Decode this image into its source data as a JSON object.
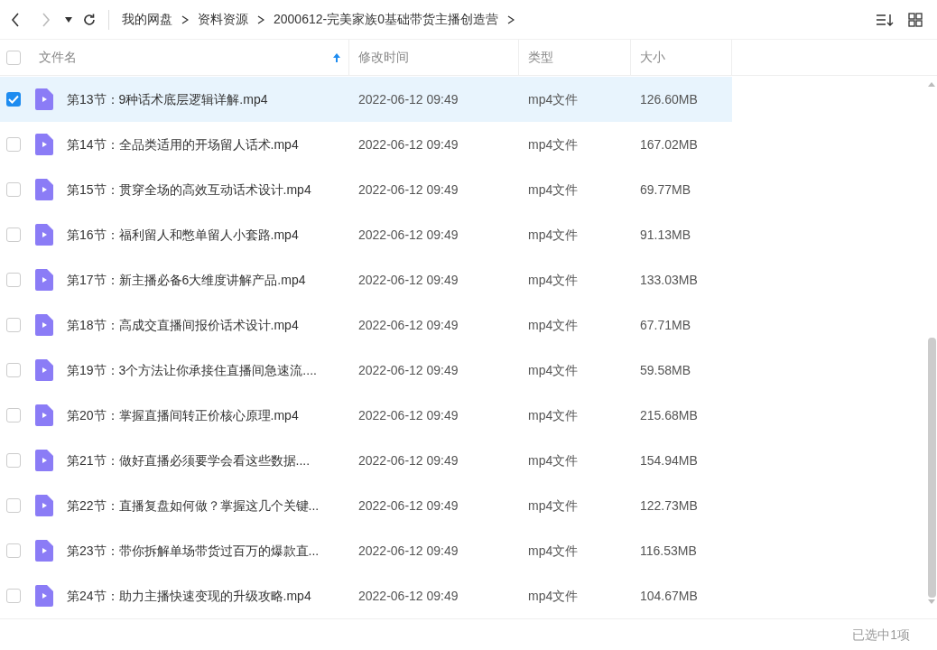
{
  "breadcrumb": [
    "我的网盘",
    "资料资源",
    "2000612-完美家族0基础带货主播创造营"
  ],
  "columns": [
    {
      "label": "文件名",
      "sorted": true
    },
    {
      "label": "修改时间",
      "sorted": false
    },
    {
      "label": "类型",
      "sorted": false
    },
    {
      "label": "大小",
      "sorted": false
    }
  ],
  "header_checked": false,
  "rows": [
    {
      "name": "第13节：9种话术底层逻辑详解.mp4",
      "modified": "2022-06-12 09:49",
      "type": "mp4文件",
      "size": "126.60MB",
      "selected": true
    },
    {
      "name": "第14节：全品类适用的开场留人话术.mp4",
      "modified": "2022-06-12 09:49",
      "type": "mp4文件",
      "size": "167.02MB",
      "selected": false
    },
    {
      "name": "第15节：贯穿全场的高效互动话术设计.mp4",
      "modified": "2022-06-12 09:49",
      "type": "mp4文件",
      "size": "69.77MB",
      "selected": false
    },
    {
      "name": "第16节：福利留人和憋单留人小套路.mp4",
      "modified": "2022-06-12 09:49",
      "type": "mp4文件",
      "size": "91.13MB",
      "selected": false
    },
    {
      "name": "第17节：新主播必备6大维度讲解产品.mp4",
      "modified": "2022-06-12 09:49",
      "type": "mp4文件",
      "size": "133.03MB",
      "selected": false
    },
    {
      "name": "第18节：高成交直播间报价话术设计.mp4",
      "modified": "2022-06-12 09:49",
      "type": "mp4文件",
      "size": "67.71MB",
      "selected": false
    },
    {
      "name": "第19节：3个方法让你承接住直播间急速流....",
      "modified": "2022-06-12 09:49",
      "type": "mp4文件",
      "size": "59.58MB",
      "selected": false
    },
    {
      "name": "第20节：掌握直播间转正价核心原理.mp4",
      "modified": "2022-06-12 09:49",
      "type": "mp4文件",
      "size": "215.68MB",
      "selected": false
    },
    {
      "name": "第21节：做好直播必须要学会看这些数据....",
      "modified": "2022-06-12 09:49",
      "type": "mp4文件",
      "size": "154.94MB",
      "selected": false
    },
    {
      "name": "第22节：直播复盘如何做？掌握这几个关键...",
      "modified": "2022-06-12 09:49",
      "type": "mp4文件",
      "size": "122.73MB",
      "selected": false
    },
    {
      "name": "第23节：带你拆解单场带货过百万的爆款直...",
      "modified": "2022-06-12 09:49",
      "type": "mp4文件",
      "size": "116.53MB",
      "selected": false
    },
    {
      "name": "第24节：助力主播快速变现的升级攻略.mp4",
      "modified": "2022-06-12 09:49",
      "type": "mp4文件",
      "size": "104.67MB",
      "selected": false
    }
  ],
  "status_bar": "已选中1项"
}
